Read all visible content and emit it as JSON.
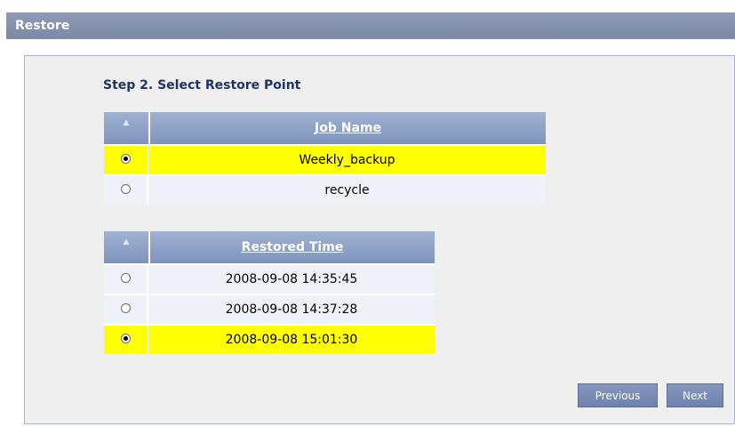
{
  "window": {
    "title": "Restore"
  },
  "step": {
    "title": "Step 2. Select Restore Point"
  },
  "jobs": {
    "header": "Job Name",
    "rows": [
      {
        "name": "Weekly_backup",
        "selected": true
      },
      {
        "name": "recycle",
        "selected": false
      }
    ]
  },
  "times": {
    "header": "Restored Time",
    "rows": [
      {
        "time": "2008-09-08 14:35:45",
        "selected": false
      },
      {
        "time": "2008-09-08 14:37:28",
        "selected": false
      },
      {
        "time": "2008-09-08 15:01:30",
        "selected": true
      }
    ]
  },
  "buttons": {
    "previous": "Previous",
    "next": "Next"
  },
  "icons": {
    "sort": "sort-ascending-icon",
    "radio": "radio-button"
  },
  "colors": {
    "highlight": "#ffff00",
    "title_bar": "#8592af",
    "header": "#8a9dc3",
    "step_title": "#1d3468"
  }
}
